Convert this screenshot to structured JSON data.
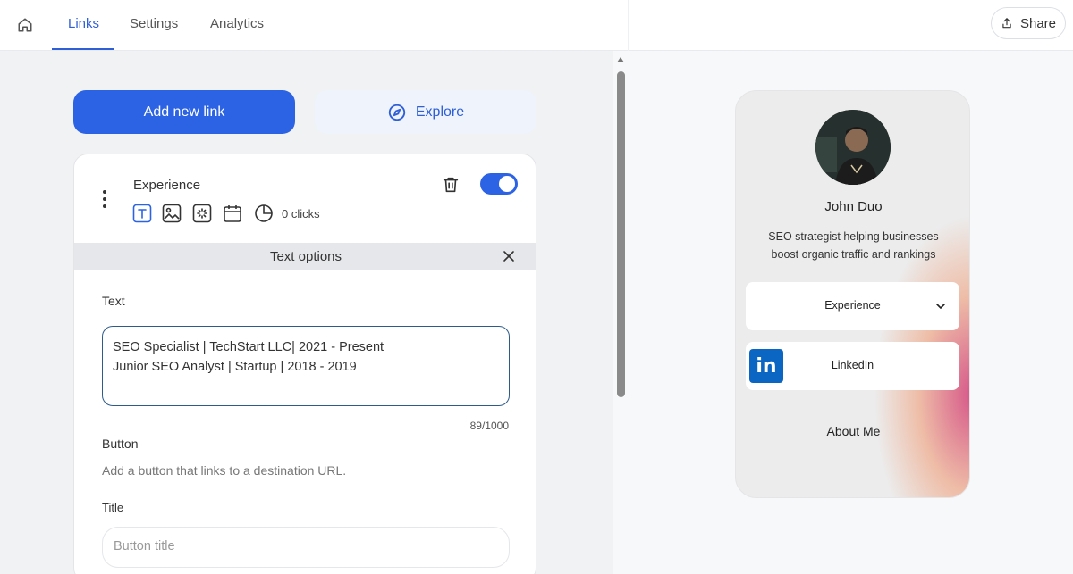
{
  "header": {
    "tabs": [
      {
        "label": "Links",
        "active": true
      },
      {
        "label": "Settings",
        "active": false
      },
      {
        "label": "Analytics",
        "active": false
      }
    ],
    "share_label": "Share"
  },
  "actions": {
    "add_link_label": "Add new link",
    "explore_label": "Explore"
  },
  "link_card": {
    "title": "Experience",
    "enabled": true,
    "clicks_label": "0 clicks",
    "tool_icons": [
      "text-icon",
      "image-icon",
      "animation-icon",
      "calendar-icon",
      "pie-chart-icon"
    ]
  },
  "text_options": {
    "header": "Text options",
    "text_label": "Text",
    "text_value": "SEO Specialist | TechStart LLC| 2021 - Present\nJunior SEO Analyst | Startup | 2018 - 2019",
    "char_count": "89/1000",
    "button_label": "Button",
    "button_hint": "Add a button that links to a destination URL.",
    "title_label": "Title",
    "title_placeholder": "Button title"
  },
  "preview": {
    "name": "John Duo",
    "bio": "SEO strategist helping businesses boost organic traffic and rankings",
    "buttons": [
      {
        "label": "Experience",
        "icon": "chevron-down-icon"
      },
      {
        "label": "LinkedIn",
        "icon": "linkedin-logo"
      }
    ],
    "linkedin_logo_text": "in",
    "about_label": "About Me"
  },
  "colors": {
    "accent": "#2c63e4",
    "active_tab": "#2f5fd6",
    "linkedin": "#0a66c2"
  }
}
